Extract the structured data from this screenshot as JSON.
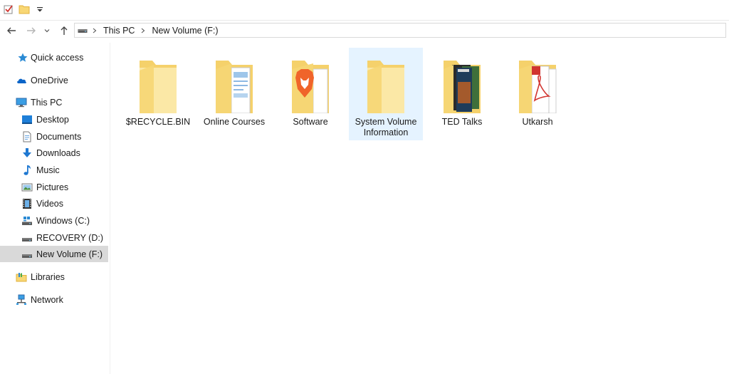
{
  "toolbar": {
    "icons": [
      "properties-checkbox-icon",
      "new-folder-icon",
      "customize-dropdown-icon"
    ]
  },
  "navigation": {
    "back_icon": "arrow-left-icon",
    "forward_icon": "arrow-right-icon",
    "recent_icon": "chevron-down-icon",
    "up_icon": "arrow-up-icon"
  },
  "address": {
    "drive_icon": "drive-icon",
    "crumbs": [
      "This PC",
      "New Volume (F:)"
    ]
  },
  "sidebar": {
    "items": [
      {
        "label": "Quick access",
        "icon": "star-icon"
      },
      {
        "label": "OneDrive",
        "icon": "cloud-icon"
      },
      {
        "label": "This PC",
        "icon": "computer-icon"
      },
      {
        "label": "Desktop",
        "icon": "desktop-icon"
      },
      {
        "label": "Documents",
        "icon": "document-icon"
      },
      {
        "label": "Downloads",
        "icon": "download-icon"
      },
      {
        "label": "Music",
        "icon": "music-icon"
      },
      {
        "label": "Pictures",
        "icon": "picture-icon"
      },
      {
        "label": "Videos",
        "icon": "video-icon"
      },
      {
        "label": "Windows (C:)",
        "icon": "windows-drive-icon"
      },
      {
        "label": "RECOVERY (D:)",
        "icon": "drive-icon"
      },
      {
        "label": "New Volume (F:)",
        "icon": "drive-icon",
        "selected": true
      },
      {
        "label": "Libraries",
        "icon": "libraries-icon"
      },
      {
        "label": "Network",
        "icon": "network-icon"
      }
    ]
  },
  "files": [
    {
      "name": "$RECYCLE.BIN",
      "icon": "folder-icon"
    },
    {
      "name": "Online Courses",
      "icon": "folder-documents-icon"
    },
    {
      "name": "Software",
      "icon": "folder-brave-icon"
    },
    {
      "name": "System Volume Information",
      "icon": "folder-icon",
      "selected": true
    },
    {
      "name": "TED Talks",
      "icon": "folder-images-icon"
    },
    {
      "name": "Utkarsh",
      "icon": "folder-pdf-icon"
    }
  ],
  "colors": {
    "folder": "#f8d775",
    "folder_light": "#fce9a6",
    "selection": "#e5f3ff",
    "nav_selected": "#d9d9d9",
    "accent": "#0078d7"
  }
}
